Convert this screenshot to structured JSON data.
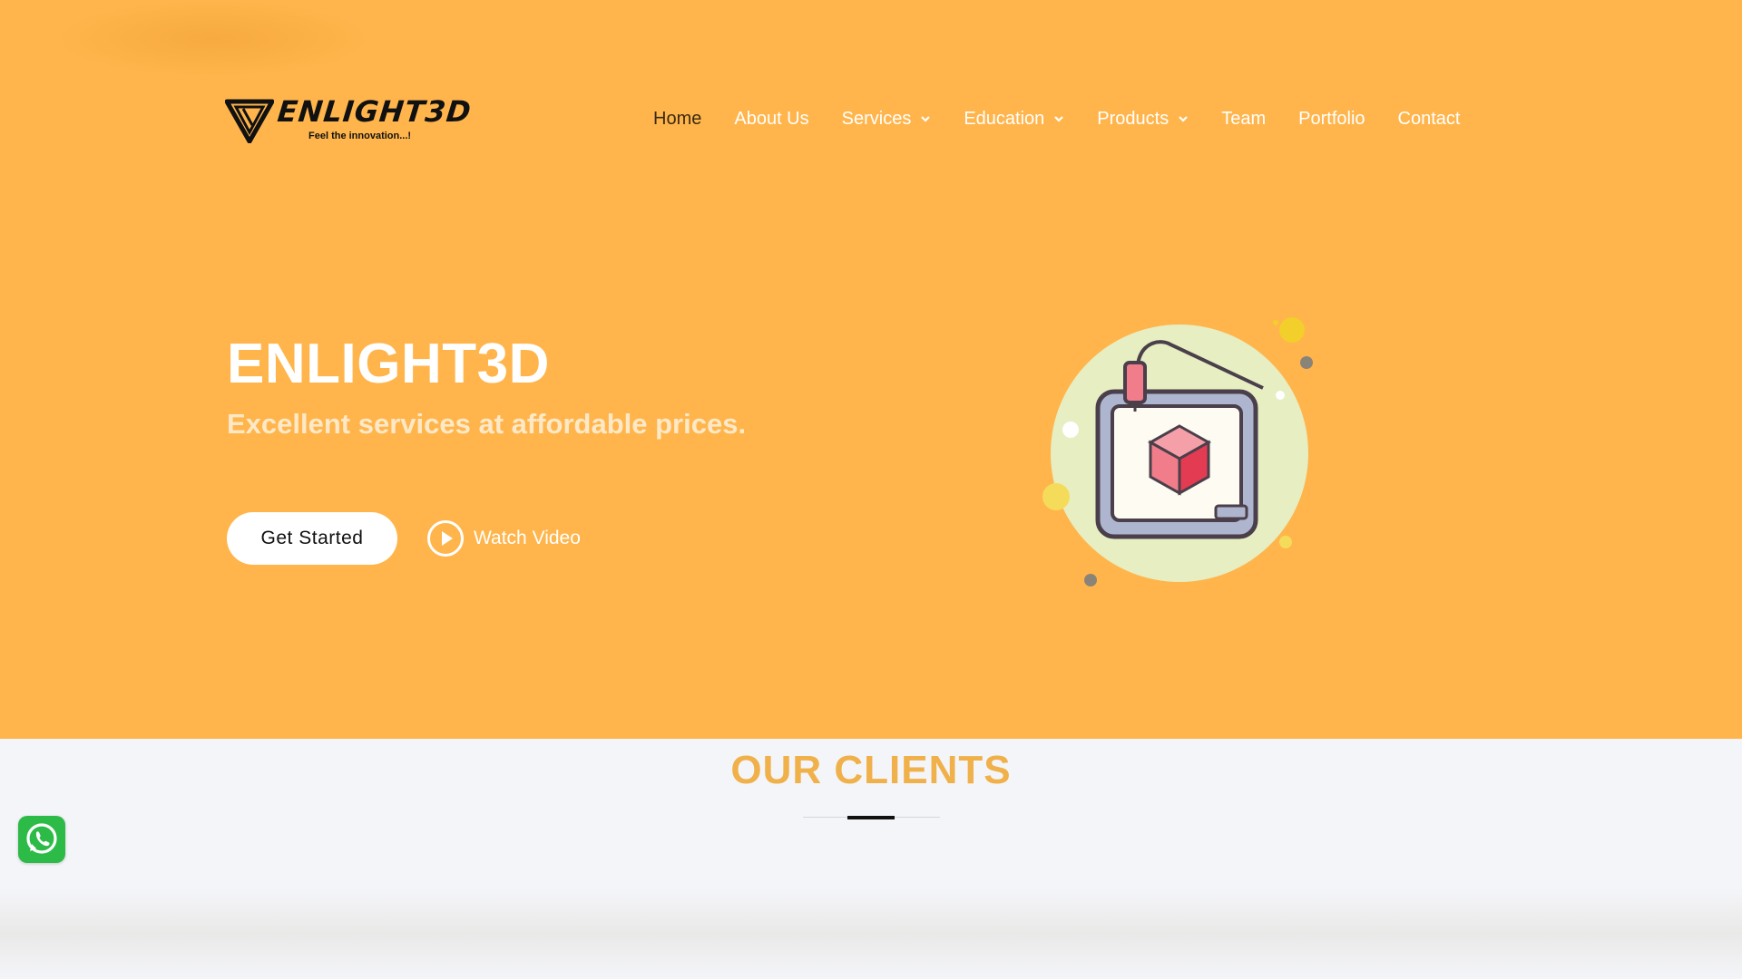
{
  "brand": {
    "name": "ENLIGHT3D",
    "tagline": "Feel the innovation...!"
  },
  "nav": {
    "items": [
      {
        "label": "Home",
        "dropdown": false,
        "active": true
      },
      {
        "label": "About Us",
        "dropdown": false,
        "active": false
      },
      {
        "label": "Services",
        "dropdown": true,
        "active": false
      },
      {
        "label": "Education",
        "dropdown": true,
        "active": false
      },
      {
        "label": "Products",
        "dropdown": true,
        "active": false
      },
      {
        "label": "Team",
        "dropdown": false,
        "active": false
      },
      {
        "label": "Portfolio",
        "dropdown": false,
        "active": false
      },
      {
        "label": "Contact",
        "dropdown": false,
        "active": false
      }
    ]
  },
  "hero": {
    "title": "ENLIGHT3D",
    "subtitle": "Excellent services at affordable prices.",
    "cta_label": "Get Started",
    "video_label": "Watch Video",
    "illustration_icon": "3d-printer-icon"
  },
  "clients": {
    "title": "OUR CLIENTS"
  },
  "floating": {
    "whatsapp_icon": "whatsapp-icon"
  },
  "colors": {
    "hero_bg": "#ffb54b",
    "accent": "#f0b04a",
    "section_bg": "#f4f5f9",
    "whatsapp": "#2dbb48"
  }
}
